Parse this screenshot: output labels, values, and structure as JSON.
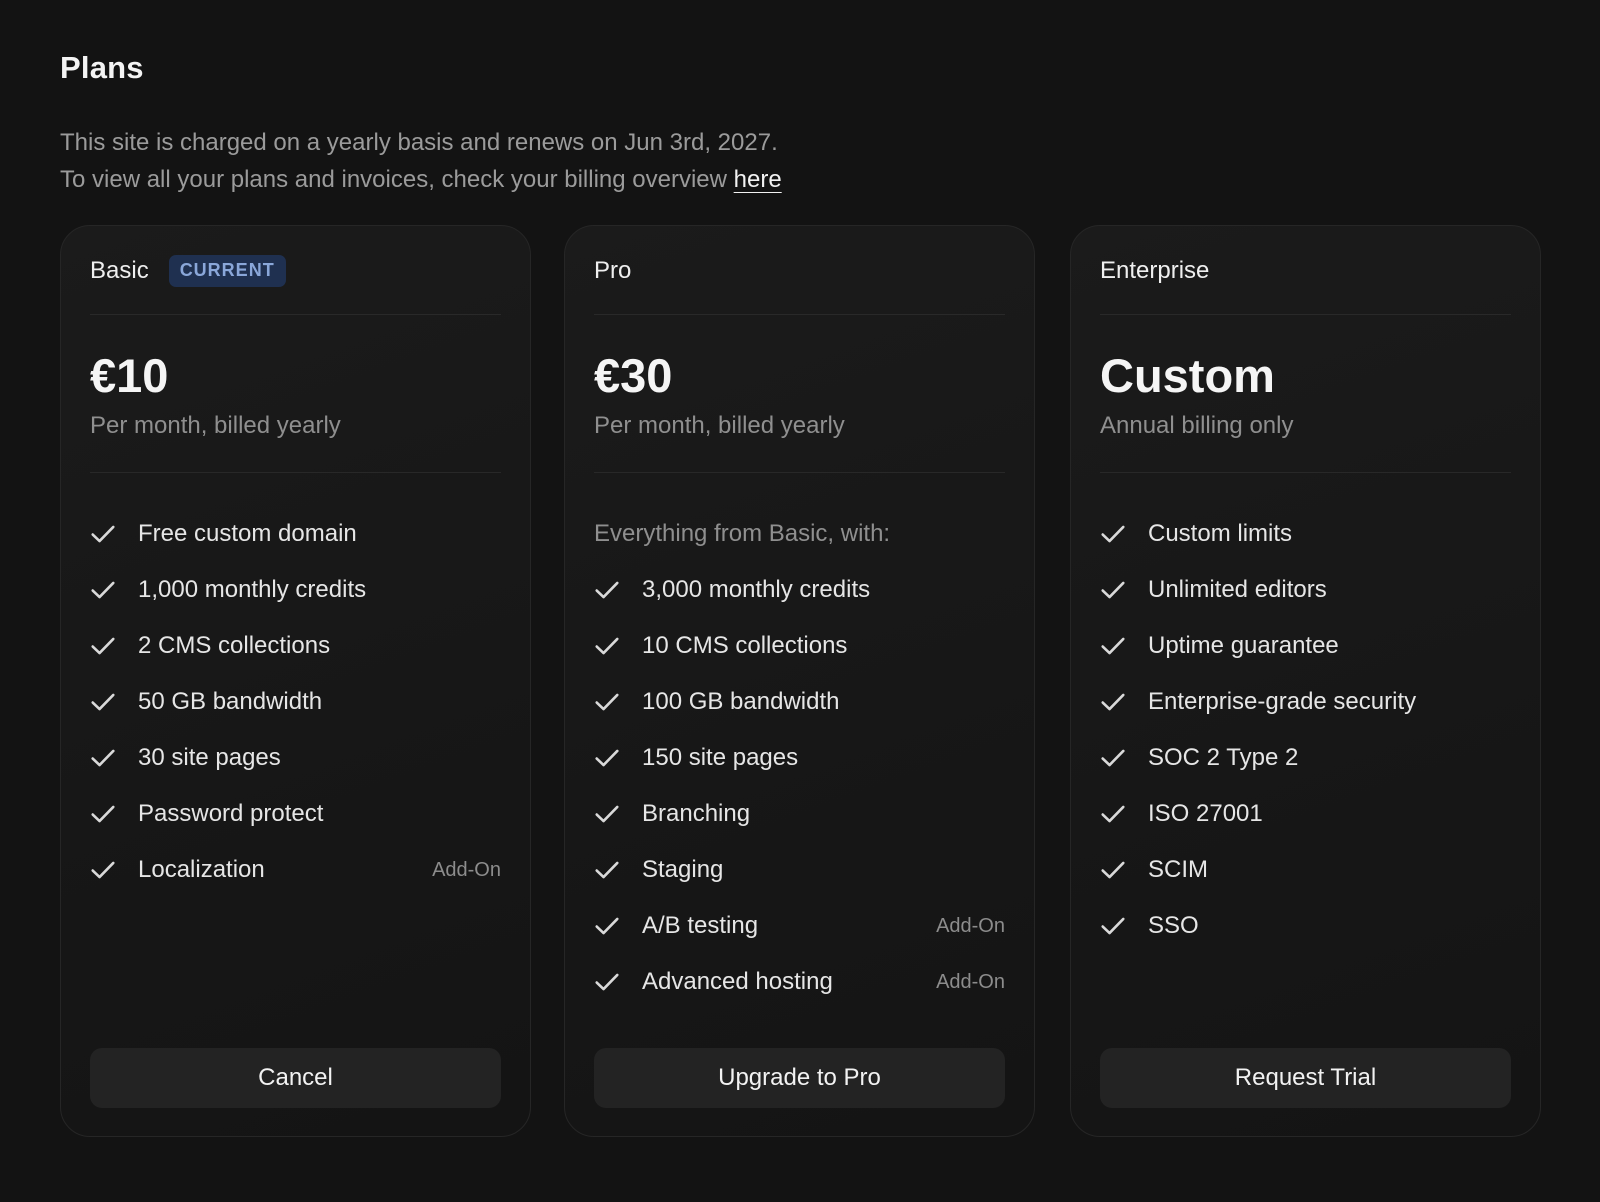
{
  "page": {
    "title": "Plans",
    "intro_line1": "This site is charged on a yearly basis and renews on Jun 3rd, 2027.",
    "intro_line2": "To view all your plans and invoices, check your billing overview ",
    "intro_link": "here"
  },
  "colors": {
    "background": "#131313",
    "card": "#181818",
    "badge_bg": "#1f3050",
    "badge_text": "#8aa7d9",
    "button": "#232323"
  },
  "plans": [
    {
      "name": "Basic",
      "badge": "CURRENT",
      "price": "€10",
      "billing": "Per month, billed yearly",
      "lead": "",
      "features": [
        {
          "label": "Free custom domain",
          "addon": ""
        },
        {
          "label": "1,000 monthly credits",
          "addon": ""
        },
        {
          "label": "2 CMS collections",
          "addon": ""
        },
        {
          "label": "50 GB bandwidth",
          "addon": ""
        },
        {
          "label": "30 site pages",
          "addon": ""
        },
        {
          "label": "Password protect",
          "addon": ""
        },
        {
          "label": "Localization",
          "addon": "Add-On"
        }
      ],
      "action": "Cancel"
    },
    {
      "name": "Pro",
      "badge": "",
      "price": "€30",
      "billing": "Per month, billed yearly",
      "lead": "Everything from Basic, with:",
      "features": [
        {
          "label": "3,000 monthly credits",
          "addon": ""
        },
        {
          "label": "10 CMS collections",
          "addon": ""
        },
        {
          "label": "100 GB bandwidth",
          "addon": ""
        },
        {
          "label": "150 site pages",
          "addon": ""
        },
        {
          "label": "Branching",
          "addon": ""
        },
        {
          "label": "Staging",
          "addon": ""
        },
        {
          "label": "A/B testing",
          "addon": "Add-On"
        },
        {
          "label": "Advanced hosting",
          "addon": "Add-On"
        }
      ],
      "action": "Upgrade to Pro"
    },
    {
      "name": "Enterprise",
      "badge": "",
      "price": "Custom",
      "billing": "Annual billing only",
      "lead": "",
      "features": [
        {
          "label": "Custom limits",
          "addon": ""
        },
        {
          "label": "Unlimited editors",
          "addon": ""
        },
        {
          "label": "Uptime guarantee",
          "addon": ""
        },
        {
          "label": "Enterprise-grade security",
          "addon": ""
        },
        {
          "label": "SOC 2 Type 2",
          "addon": ""
        },
        {
          "label": "ISO 27001",
          "addon": ""
        },
        {
          "label": "SCIM",
          "addon": ""
        },
        {
          "label": "SSO",
          "addon": ""
        }
      ],
      "action": "Request Trial"
    }
  ],
  "icons": {
    "feature_check": "check-icon"
  }
}
